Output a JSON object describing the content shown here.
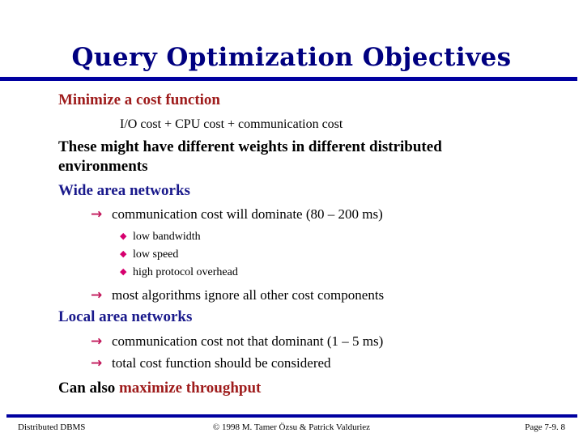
{
  "slide": {
    "title": "Query Optimization Objectives",
    "colors": {
      "title": "#000080",
      "rule": "#0000a0",
      "heading_red": "#9e1b1b",
      "heading_blue": "#1a1a8c",
      "body_black": "#000000",
      "arrow_bullet": "#c2185b",
      "diamond_bullet": "#d6006e"
    },
    "bullets": {
      "arrow_icon": "arrow-right-icon",
      "arrow_glyph": "→",
      "diamond_icon": "diamond-icon",
      "diamond_glyph": "◆"
    },
    "lines": {
      "minimize_cost": "Minimize a cost function",
      "cost_formula": "I/O cost + CPU cost + communication cost",
      "different_weights": "These might have different weights in different distributed environments",
      "wide_area_networks": "Wide area networks",
      "wan_comm_cost": "communication cost will dominate (80 – 200 ms)",
      "low_bandwidth": "low bandwidth",
      "low_speed": "low speed",
      "high_protocol_overhead": "high protocol overhead",
      "most_algorithms": "most algorithms ignore all other cost components",
      "local_area_networks": "Local area networks",
      "lan_comm_cost": "communication cost not that dominant (1 – 5 ms)",
      "total_cost_function": "total cost function should be considered",
      "can_also_prefix": "Can also ",
      "maximize_throughput": "maximize throughput"
    }
  },
  "footer": {
    "left": "Distributed DBMS",
    "center": "© 1998 M. Tamer Özsu & Patrick Valduriez",
    "right": "Page 7-9. 8"
  }
}
